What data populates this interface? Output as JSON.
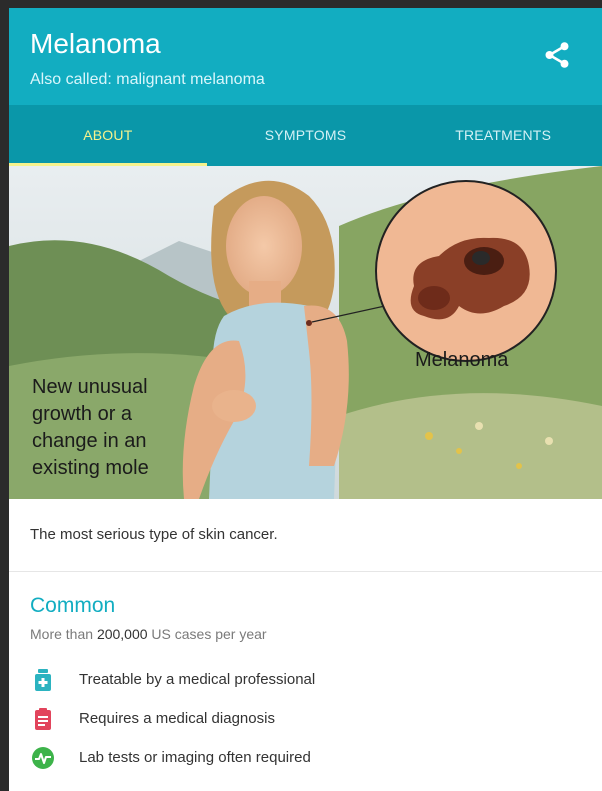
{
  "header": {
    "title": "Melanoma",
    "subtitle": "Also called: malignant melanoma",
    "share_icon": "share-icon",
    "color": "#12adc1"
  },
  "tabs": [
    {
      "label": "ABOUT",
      "active": true
    },
    {
      "label": "SYMPTOMS",
      "active": false
    },
    {
      "label": "TREATMENTS",
      "active": false
    }
  ],
  "hero": {
    "caption": "New unusual growth or a change in an existing mole",
    "zoom_label": "Melanoma"
  },
  "description": "The most serious type of skin cancer.",
  "section": {
    "title": "Common",
    "sub_prefix": "More than ",
    "sub_value": "200,000",
    "sub_suffix": " US cases per year"
  },
  "facts": [
    {
      "text": "Treatable by a medical professional",
      "icon": "medicine-bottle-icon",
      "color": "#2bb3c0"
    },
    {
      "text": "Requires a medical diagnosis",
      "icon": "clipboard-icon",
      "color": "#e2445c"
    },
    {
      "text": "Lab tests or imaging often required",
      "icon": "pulse-icon",
      "color": "#3db34a"
    }
  ]
}
